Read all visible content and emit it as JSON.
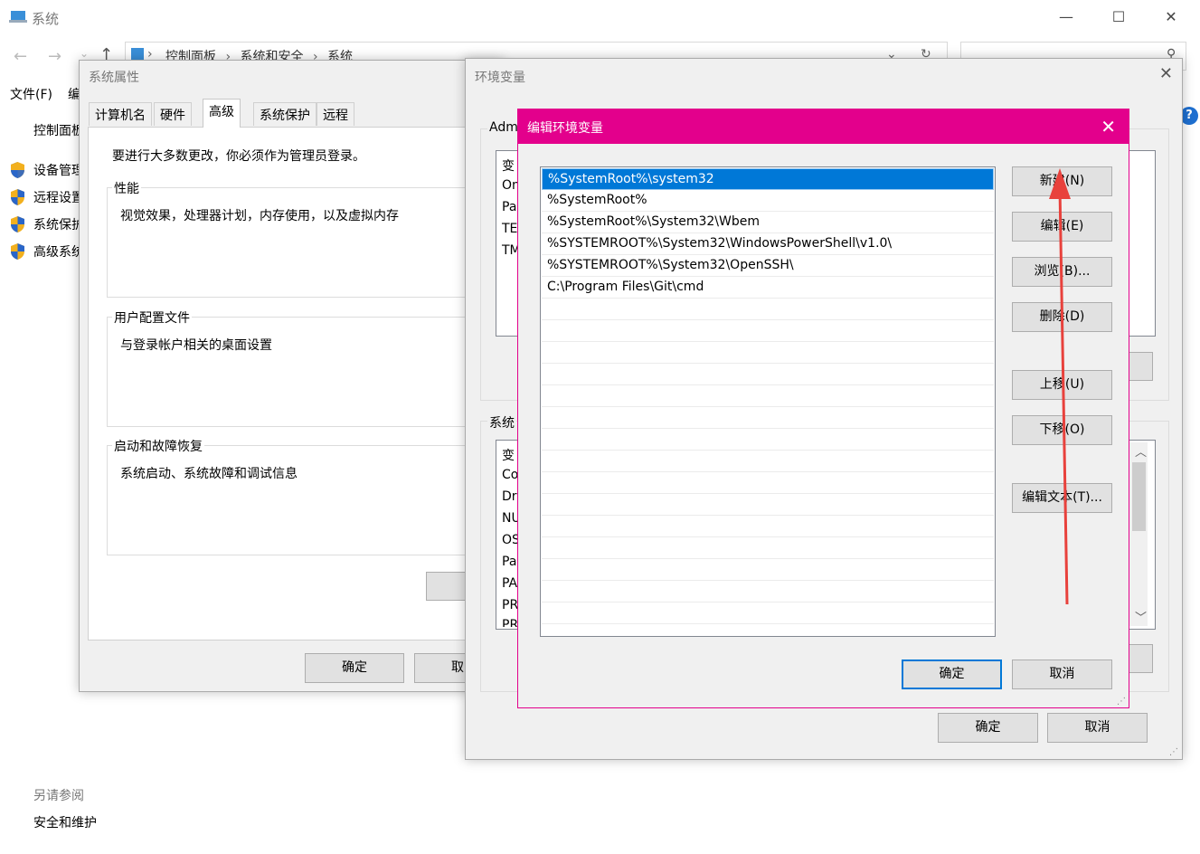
{
  "system_window": {
    "title": "系统",
    "breadcrumb": [
      "控制面板",
      "系统和安全",
      "系统"
    ],
    "menu": {
      "file": "文件(F)",
      "edit": "编"
    },
    "sidebar": {
      "home": "控制面板",
      "items": [
        {
          "label": "设备管理"
        },
        {
          "label": "远程设置"
        },
        {
          "label": "系统保护"
        },
        {
          "label": "高级系统"
        }
      ],
      "see_also": "另请参阅",
      "security_maintenance": "安全和维护"
    }
  },
  "system_properties": {
    "title": "系统属性",
    "tabs": [
      "计算机名",
      "硬件",
      "高级",
      "系统保护",
      "远程"
    ],
    "active_tab": "高级",
    "admin_note": "要进行大多数更改，你必须作为管理员登录。",
    "groups": [
      {
        "label": "性能",
        "desc": "视觉效果，处理器计划，内存使用，以及虚拟内存"
      },
      {
        "label": "用户配置文件",
        "desc": "与登录帐户相关的桌面设置"
      },
      {
        "label": "启动和故障恢复",
        "desc": "系统启动、系统故障和调试信息"
      }
    ],
    "ok": "确定",
    "cancel": "取"
  },
  "env_vars": {
    "title": "环境变量",
    "user_group_label": "Adm",
    "user_rows": [
      "变",
      "On",
      "Pa",
      "TE",
      "TM"
    ],
    "sys_group_label": "系统",
    "sys_rows": [
      "变",
      "Co",
      "Dr",
      "NU",
      "OS",
      "Pa",
      "PA",
      "PR",
      "PR"
    ],
    "ok": "确定",
    "cancel": "取消"
  },
  "edit_dialog": {
    "title": "编辑环境变量",
    "paths": [
      "%SystemRoot%\\system32",
      "%SystemRoot%",
      "%SystemRoot%\\System32\\Wbem",
      "%SYSTEMROOT%\\System32\\WindowsPowerShell\\v1.0\\",
      "%SYSTEMROOT%\\System32\\OpenSSH\\",
      "C:\\Program Files\\Git\\cmd"
    ],
    "selected_index": 0,
    "buttons": {
      "new": "新建(N)",
      "edit": "编辑(E)",
      "browse": "浏览(B)...",
      "delete": "删除(D)",
      "move_up": "上移(U)",
      "move_down": "下移(O)",
      "edit_text": "编辑文本(T)...",
      "ok": "确定",
      "cancel": "取消"
    }
  },
  "colors": {
    "accent_titlebar": "#e3008c",
    "selection": "#0078d7",
    "annotation_arrow": "#e8413c"
  }
}
